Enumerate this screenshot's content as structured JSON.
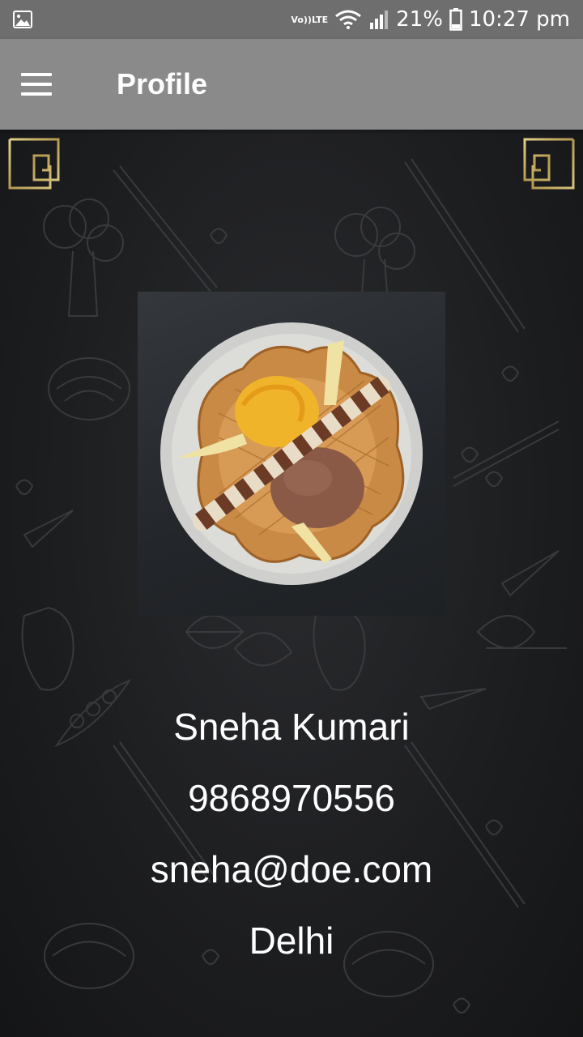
{
  "status_bar": {
    "volte_top": "Vo))",
    "volte_bottom": "LTE",
    "battery": "21%",
    "time": "10:27 pm",
    "icons": [
      "image-icon",
      "wifi-icon",
      "signal-icon",
      "battery-icon"
    ]
  },
  "app_bar": {
    "title": "Profile",
    "menu_icon": "hamburger-menu-icon"
  },
  "profile": {
    "photo_icon": "dessert-photo",
    "name": "Sneha Kumari",
    "phone": "9868970556",
    "email": "sneha@doe.com",
    "city": "Delhi"
  },
  "colors": {
    "status_bar": "#6e6e6e",
    "app_bar": "#8a8a8a",
    "background": "#1c1d1f",
    "frame_gold": "#c9b26a",
    "text": "#ffffff"
  }
}
